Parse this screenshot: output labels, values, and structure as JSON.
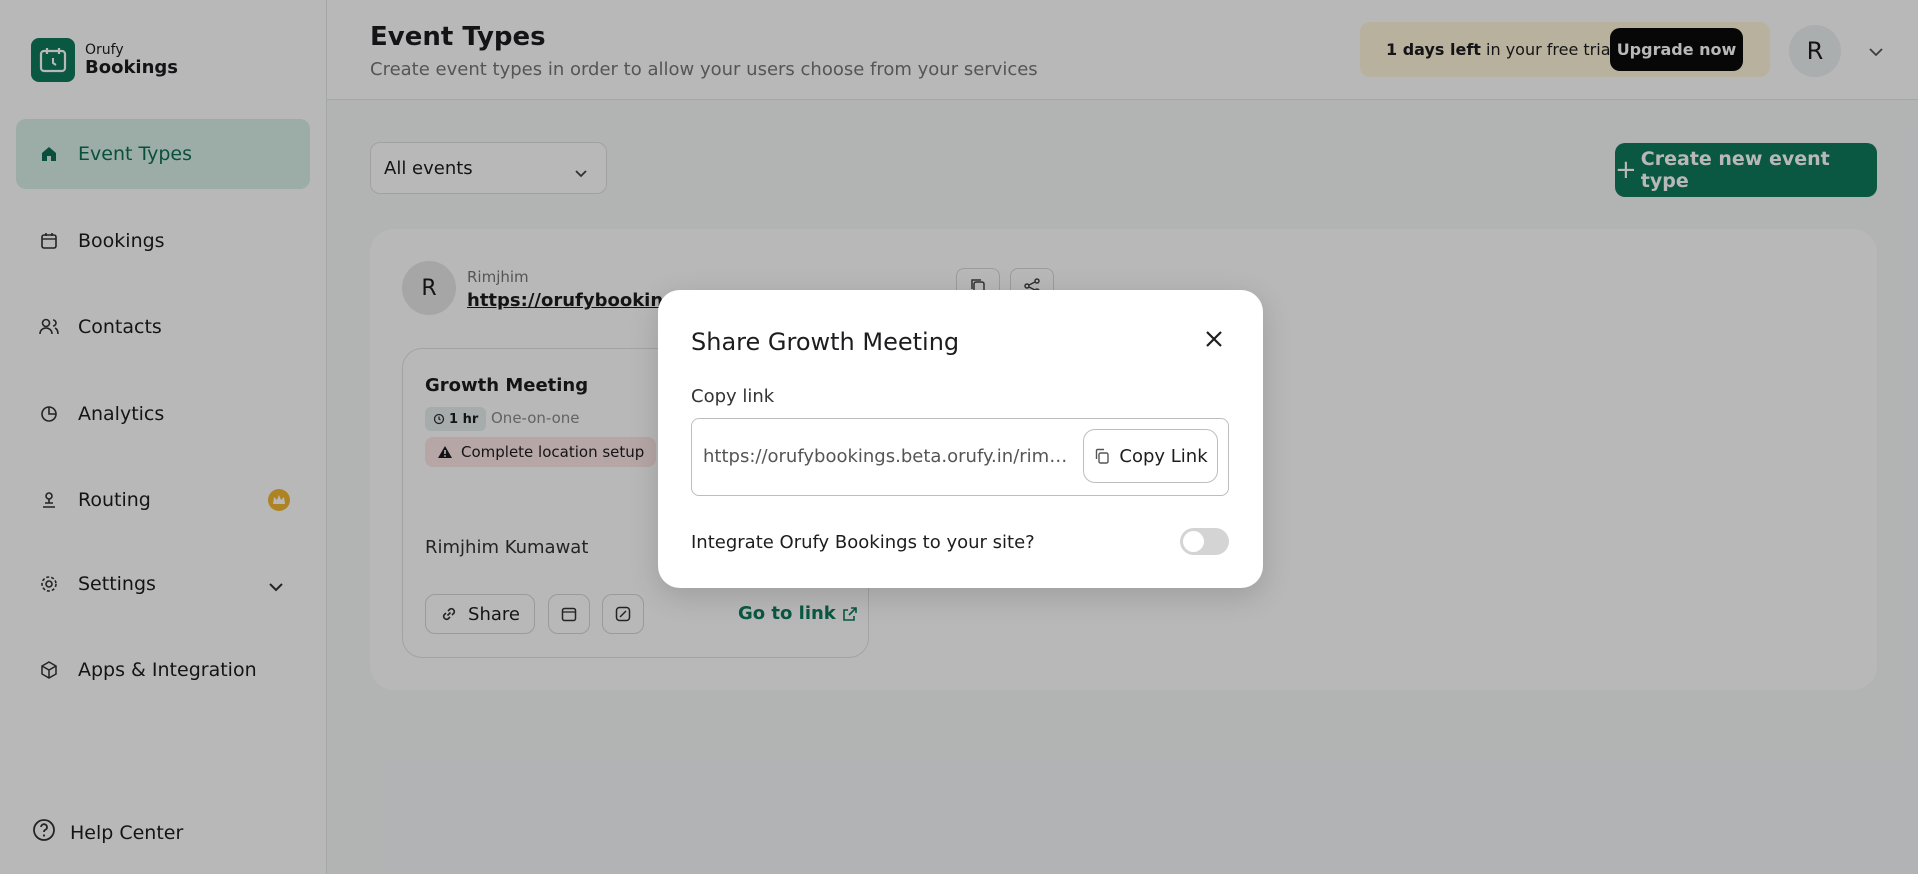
{
  "app": {
    "brand_small": "Orufy",
    "brand_big": "Bookings"
  },
  "sidebar": {
    "items": [
      {
        "label": "Event Types",
        "icon": "home-icon",
        "active": true
      },
      {
        "label": "Bookings",
        "icon": "calendar-icon"
      },
      {
        "label": "Contacts",
        "icon": "users-icon"
      },
      {
        "label": "Analytics",
        "icon": "pie-chart-icon"
      },
      {
        "label": "Routing",
        "icon": "routing-icon",
        "badge": "crown-icon"
      },
      {
        "label": "Settings",
        "icon": "gear-icon",
        "expandable": true
      },
      {
        "label": "Apps & Integration",
        "icon": "box-icon"
      }
    ],
    "help": "Help Center"
  },
  "header": {
    "title": "Event Types",
    "subtitle": "Create event types in order to allow your users choose from your services",
    "trial_bold": "1 days left",
    "trial_rest": " in your free trial",
    "upgrade_label": "Upgrade now",
    "avatar_initial": "R"
  },
  "main": {
    "filter_value": "All events",
    "create_label": "Create new event type",
    "owner": {
      "initial": "R",
      "name": "Rimjhim",
      "link": "https://orufybookings.beta.orufy.in/rimjhim"
    },
    "card": {
      "title": "Growth Meeting",
      "duration": "1 hr",
      "type": "One-on-one",
      "warning": "Complete location setup",
      "host": "Rimjhim Kumawat",
      "share_label": "Share",
      "goto_label": "Go to link"
    }
  },
  "modal": {
    "title": "Share Growth Meeting",
    "copy_label": "Copy link",
    "link_value": "https://orufybookings.beta.orufy.in/rimjhim-kumawat/growth-meeting",
    "copy_button": "Copy Link",
    "integrate_label": "Integrate Orufy Bookings to your site?",
    "integrate_enabled": false
  },
  "colors": {
    "brand": "#0e7a5a",
    "active_bg": "#d8efe6",
    "warning_bg": "#fde7e7",
    "trial_bg": "#fff6db"
  }
}
